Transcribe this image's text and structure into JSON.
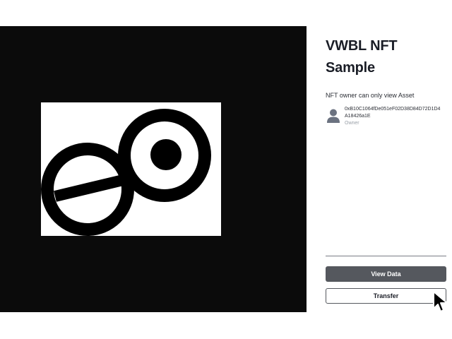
{
  "nft": {
    "title": "VWBL NFT Sample",
    "description": "NFT owner can only view Asset"
  },
  "owner": {
    "address": "0xB10C1064fDe051eF02D38D84D72D1D4A18426a1E",
    "label": "Owner"
  },
  "actions": {
    "view_data_label": "View Data",
    "transfer_label": "Transfer"
  },
  "icons": {
    "avatar": "user-avatar-icon",
    "cursor": "mouse-pointer-icon",
    "artwork": "vwbl-logo-artwork"
  },
  "colors": {
    "media_background": "#0b0b0b",
    "primary_button": "#55585e",
    "title_text": "#1a1d26"
  }
}
